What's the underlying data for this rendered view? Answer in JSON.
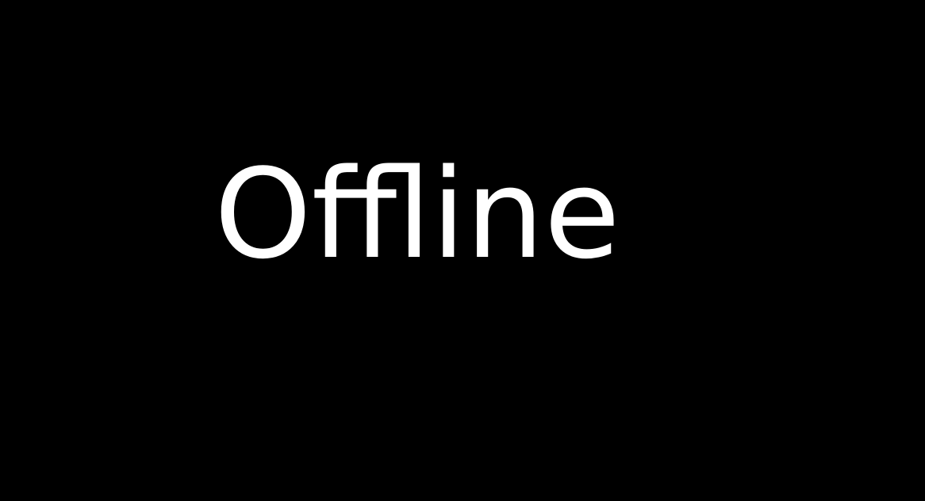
{
  "screen": {
    "status_text": "Offline",
    "background_color": "#000000",
    "text_color": "#ffffff"
  }
}
